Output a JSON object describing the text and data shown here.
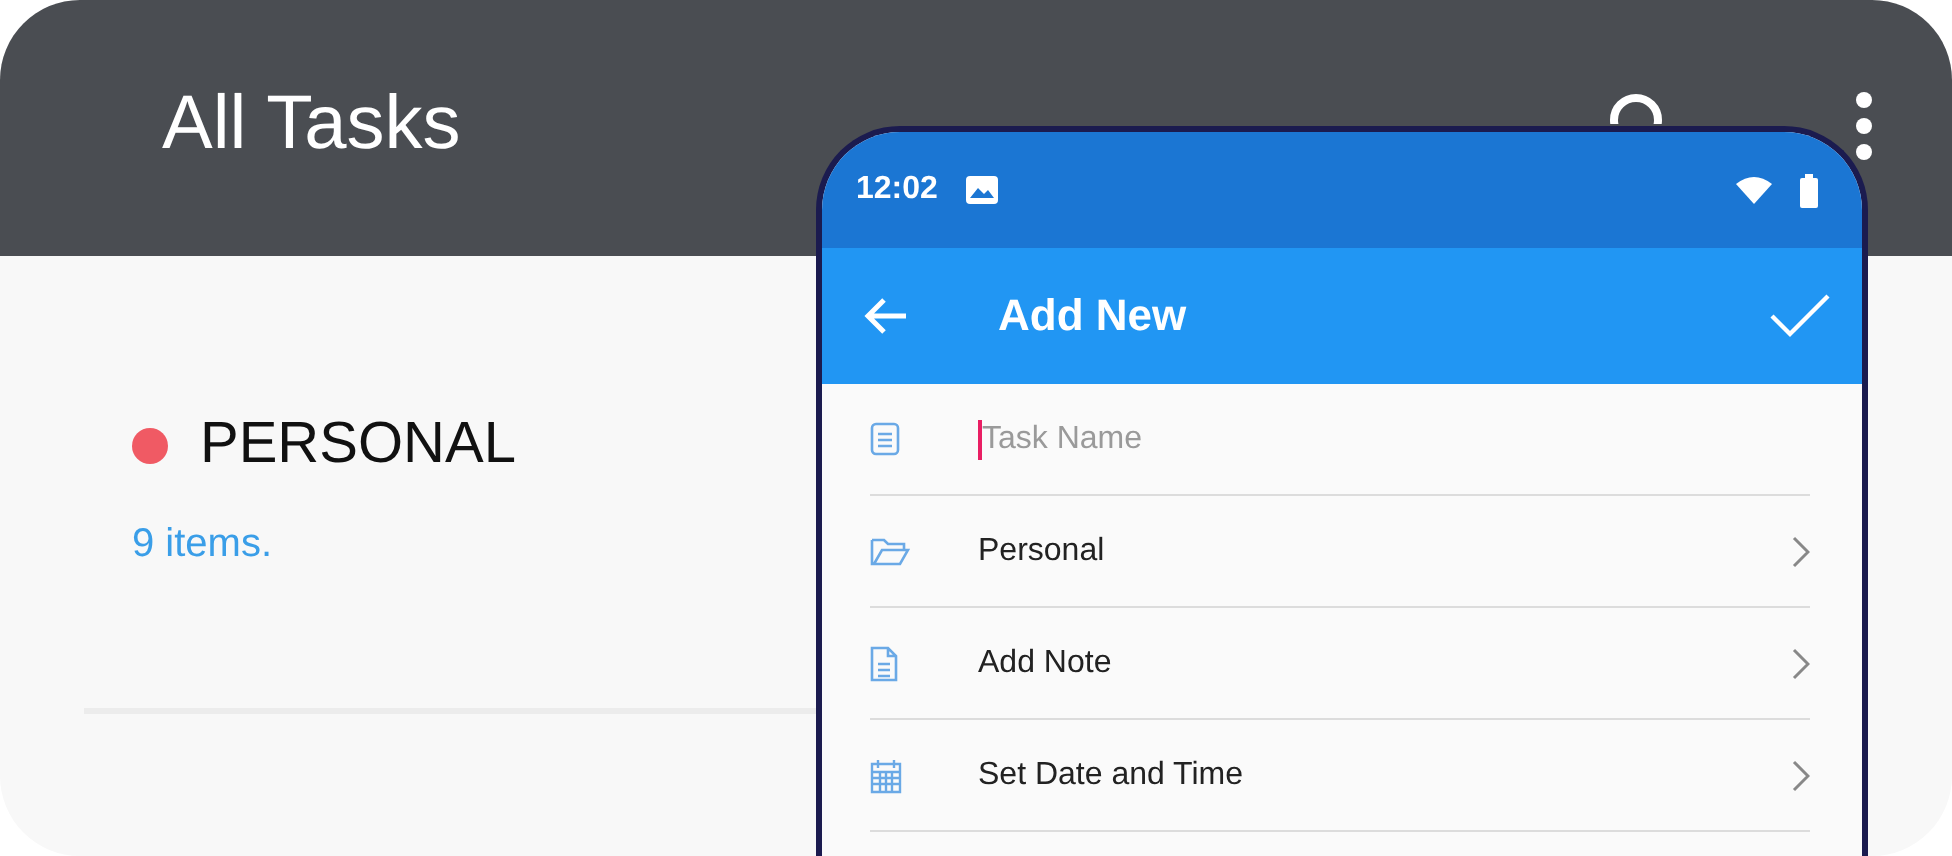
{
  "app_bar": {
    "title": "All Tasks"
  },
  "categories": [
    {
      "name": "PERSONAL",
      "color": "#f05a64",
      "count": "9 items."
    }
  ],
  "phone": {
    "status_bar": {
      "time": "12:02"
    },
    "toolbar": {
      "title": "Add New"
    },
    "form": {
      "task_name": {
        "placeholder": "Task Name"
      },
      "rows": [
        {
          "kind": "folder",
          "label": "Personal"
        },
        {
          "kind": "note",
          "label": "Add Note"
        },
        {
          "kind": "calendar",
          "label": "Set Date and Time"
        }
      ]
    }
  }
}
